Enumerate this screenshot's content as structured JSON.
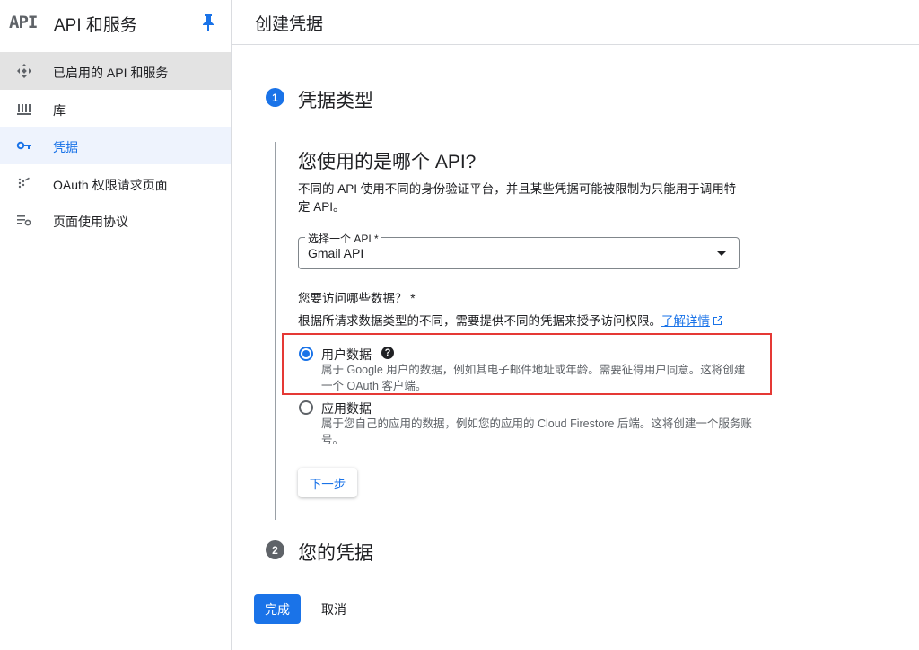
{
  "sidebar": {
    "logo_text": "API",
    "title": "API 和服务",
    "pin_icon": "pin-icon",
    "items": [
      {
        "label": "已启用的 API 和服务",
        "icon": "diamond-arrows-icon"
      },
      {
        "label": "库",
        "icon": "library-icon"
      },
      {
        "label": "凭据",
        "icon": "key-icon"
      },
      {
        "label": "OAuth 权限请求页面",
        "icon": "oauth-consent-icon"
      },
      {
        "label": "页面使用协议",
        "icon": "settings-list-icon"
      }
    ]
  },
  "header": {
    "title": "创建凭据"
  },
  "steps": [
    {
      "number": "1",
      "label": "凭据类型"
    },
    {
      "number": "2",
      "label": "您的凭据"
    }
  ],
  "api_section": {
    "title": "您使用的是哪个 API?",
    "description": "不同的 API 使用不同的身份验证平台，并且某些凭据可能被限制为只能用于调用特定 API。",
    "select_label": "选择一个 API *",
    "select_value": "Gmail API"
  },
  "data_section": {
    "question": "您要访问哪些数据？ *",
    "description": "根据所请求数据类型的不同，需要提供不同的凭据来授予访问权限。",
    "learn_more": "了解详情",
    "options": [
      {
        "title": "用户数据",
        "description": "属于 Google 用户的数据，例如其电子邮件地址或年龄。需要征得用户同意。这将创建一个 OAuth 客户端。",
        "checked": true
      },
      {
        "title": "应用数据",
        "description": "属于您自己的应用的数据，例如您的应用的 Cloud Firestore 后端。这将创建一个服务账号。",
        "checked": false
      }
    ],
    "help_glyph": "?"
  },
  "buttons": {
    "next": "下一步",
    "done": "完成",
    "cancel": "取消"
  },
  "colors": {
    "accent": "#1a73e8",
    "highlight": "#e53935"
  }
}
